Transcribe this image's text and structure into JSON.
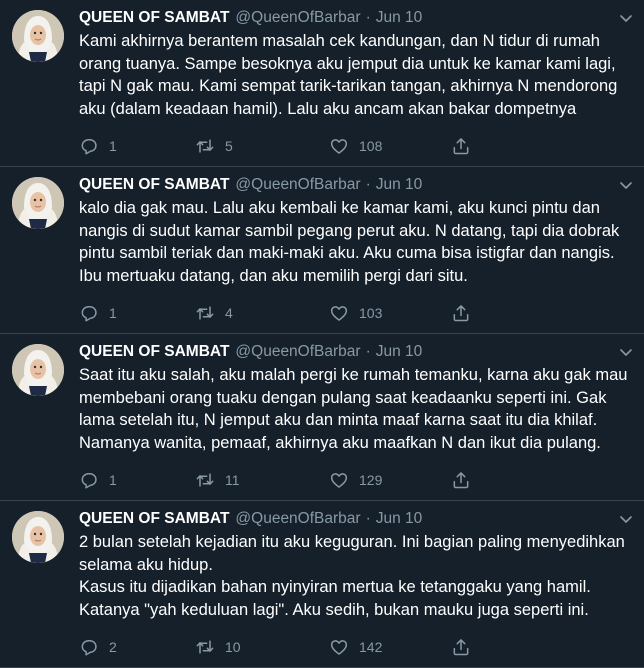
{
  "colors": {
    "background": "#15202b",
    "divider": "#38444d",
    "secondary_text": "#8899a6",
    "primary_text": "#ffffff"
  },
  "tweets": [
    {
      "name": "QUEEN OF SAMBAT",
      "handle": "@QueenOfBarbar",
      "separator": "·",
      "date": "Jun 10",
      "text": "Kami akhirnya berantem masalah cek kandungan, dan N tidur di rumah\norang tuanya. Sampe besoknya aku jemput dia untuk ke kamar kami lagi,\ntapi N gak mau. Kami sempat tarik-tarikan tangan, akhirnya N mendorong\naku (dalam keadaan hamil). Lalu aku ancam akan bakar dompetnya",
      "replies": "1",
      "retweets": "5",
      "likes": "108"
    },
    {
      "name": "QUEEN OF SAMBAT",
      "handle": "@QueenOfBarbar",
      "separator": "·",
      "date": "Jun 10",
      "text": "kalo dia gak mau. Lalu aku kembali ke kamar kami, aku kunci pintu dan\nnangis di sudut kamar sambil pegang perut aku. N datang, tapi dia dobrak\npintu sambil teriak dan maki-maki aku. Aku cuma bisa istigfar dan nangis.\nIbu mertuaku datang, dan aku memilih pergi dari situ.",
      "replies": "1",
      "retweets": "4",
      "likes": "103"
    },
    {
      "name": "QUEEN OF SAMBAT",
      "handle": "@QueenOfBarbar",
      "separator": "·",
      "date": "Jun 10",
      "text": "Saat itu aku salah, aku malah pergi ke rumah temanku, karna aku gak mau\nmembebani orang tuaku dengan pulang saat keadaanku seperti ini. Gak\nlama setelah itu, N jemput aku dan minta maaf karna saat itu dia khilaf.\nNamanya wanita, pemaaf, akhirnya aku maafkan N dan ikut dia pulang.",
      "replies": "1",
      "retweets": "11",
      "likes": "129"
    },
    {
      "name": "QUEEN OF SAMBAT",
      "handle": "@QueenOfBarbar",
      "separator": "·",
      "date": "Jun 10",
      "text": "2 bulan setelah kejadian itu aku keguguran. Ini bagian paling menyedihkan\nselama aku hidup.\nKasus itu dijadikan bahan nyinyiran mertua ke tetanggaku yang hamil.\nKatanya \"yah keduluan lagi\". Aku sedih, bukan mauku juga seperti ini.",
      "replies": "2",
      "retweets": "10",
      "likes": "142"
    }
  ]
}
